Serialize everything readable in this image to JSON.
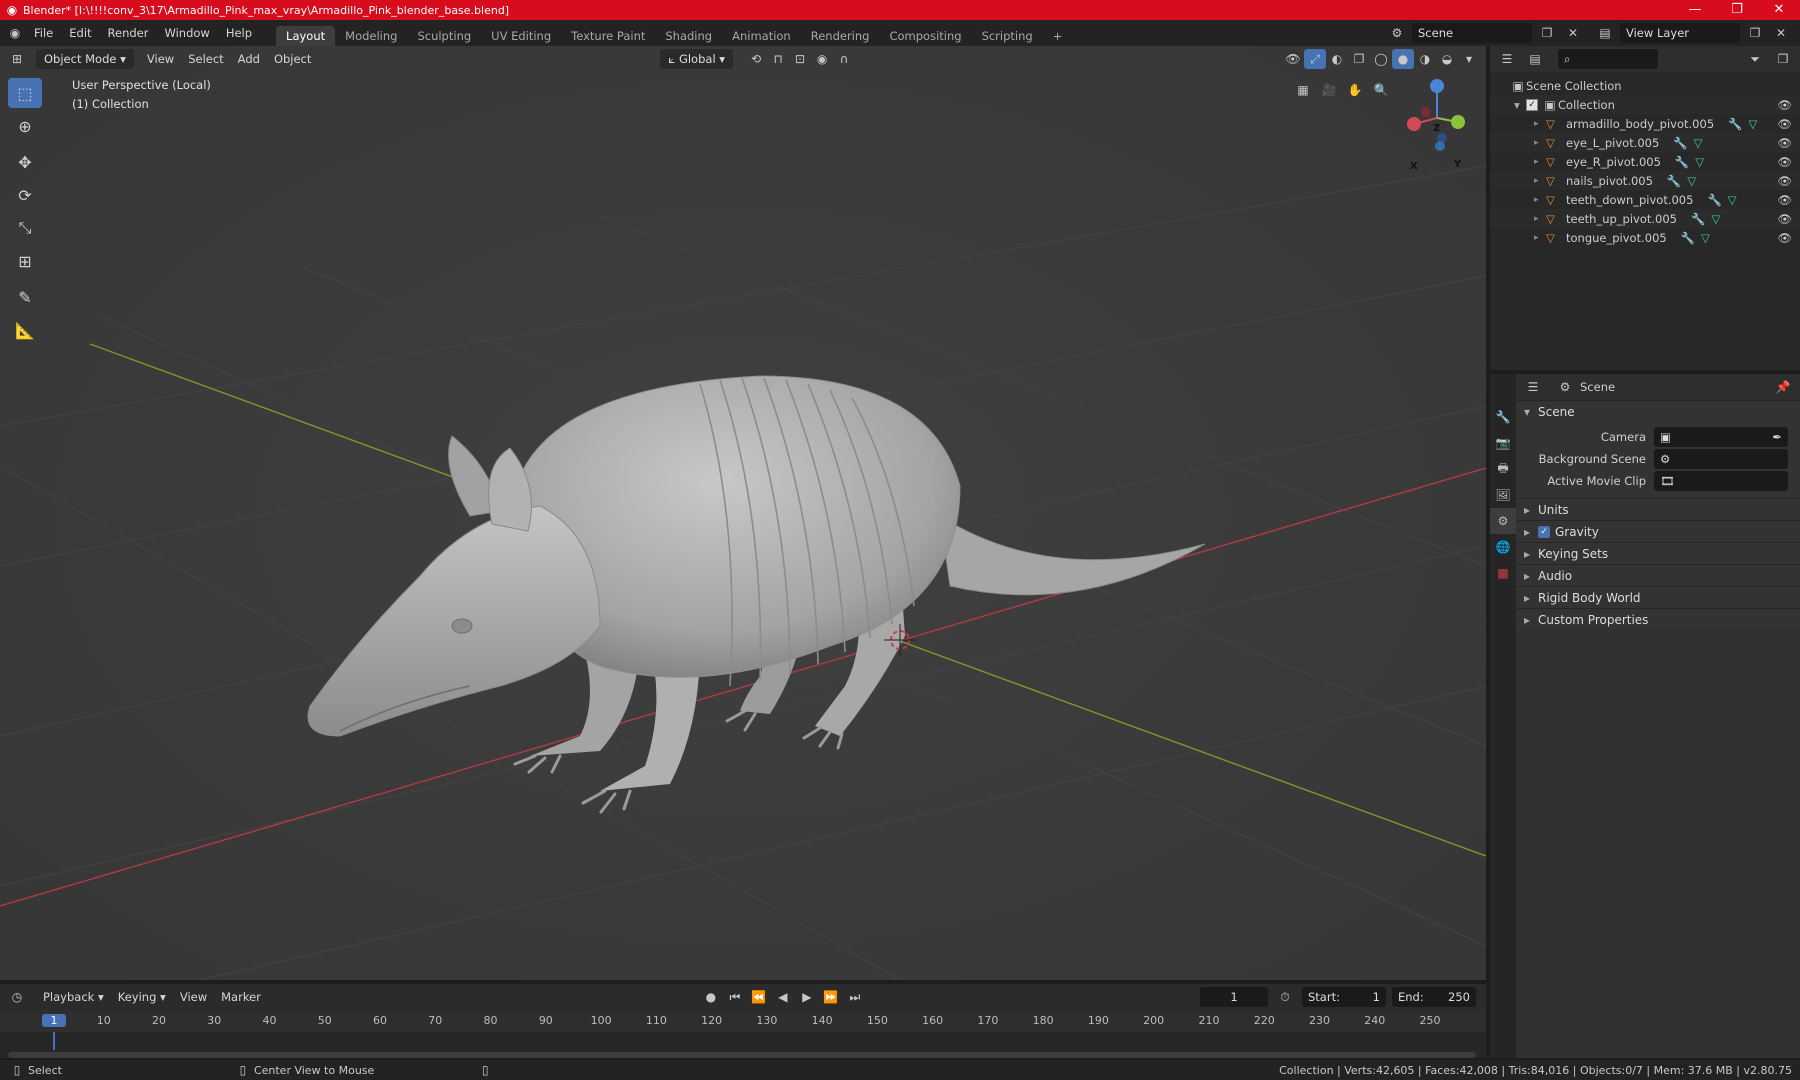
{
  "titlebar": {
    "title": "Blender* [I:\\!!!!conv_3\\17\\Armadillo_Pink_max_vray\\Armadillo_Pink_blender_base.blend]",
    "minimize": "—",
    "maximize": "❐",
    "close": "✕"
  },
  "menubar": {
    "items": [
      "File",
      "Edit",
      "Render",
      "Window",
      "Help"
    ],
    "workspaces": [
      "Layout",
      "Modeling",
      "Sculpting",
      "UV Editing",
      "Texture Paint",
      "Shading",
      "Animation",
      "Rendering",
      "Compositing",
      "Scripting"
    ],
    "add_tab": "+",
    "scene_name": "Scene",
    "view_layer": "View Layer"
  },
  "viewport": {
    "mode": "Object Mode",
    "menus": [
      "View",
      "Select",
      "Add",
      "Object"
    ],
    "transform_orientation": "Global",
    "perspective_label": "User Perspective (Local)",
    "collection_label": "(1) Collection",
    "gizmo": {
      "x": "X",
      "y": "Y",
      "z": "Z"
    }
  },
  "outliner": {
    "search_placeholder": "",
    "scene_collection": "Scene Collection",
    "collection": "Collection",
    "objects": [
      "armadillo_body_pivot.005",
      "eye_L_pivot.005",
      "eye_R_pivot.005",
      "nails_pivot.005",
      "teeth_down_pivot.005",
      "teeth_up_pivot.005",
      "tongue_pivot.005"
    ]
  },
  "properties": {
    "header_title": "Scene",
    "scene_panel": "Scene",
    "camera_label": "Camera",
    "background_scene_label": "Background Scene",
    "active_movie_clip_label": "Active Movie Clip",
    "panels": [
      "Units",
      "Gravity",
      "Keying Sets",
      "Audio",
      "Rigid Body World",
      "Custom Properties"
    ]
  },
  "timeline": {
    "menus": [
      "Playback",
      "Keying",
      "View",
      "Marker"
    ],
    "current_frame": "1",
    "start_label": "Start:",
    "start_value": "1",
    "end_label": "End:",
    "end_value": "250",
    "ruler": [
      "1",
      "10",
      "20",
      "30",
      "40",
      "50",
      "60",
      "70",
      "80",
      "90",
      "100",
      "110",
      "120",
      "130",
      "140",
      "150",
      "160",
      "170",
      "180",
      "190",
      "200",
      "210",
      "220",
      "230",
      "240",
      "250"
    ]
  },
  "statusbar": {
    "select": "Select",
    "center_view": "Center View to Mouse",
    "stats": "Collection | Verts:42,605 | Faces:42,008 | Tris:84,016 | Objects:0/7 | Mem: 37.6 MB | v2.80.75"
  },
  "colors": {
    "titlebar": "#d70c1c",
    "accent": "#4772b3",
    "x_axis": "#b03a45",
    "y_axis": "#7a9a2a",
    "mesh": "#b4b4b4"
  }
}
